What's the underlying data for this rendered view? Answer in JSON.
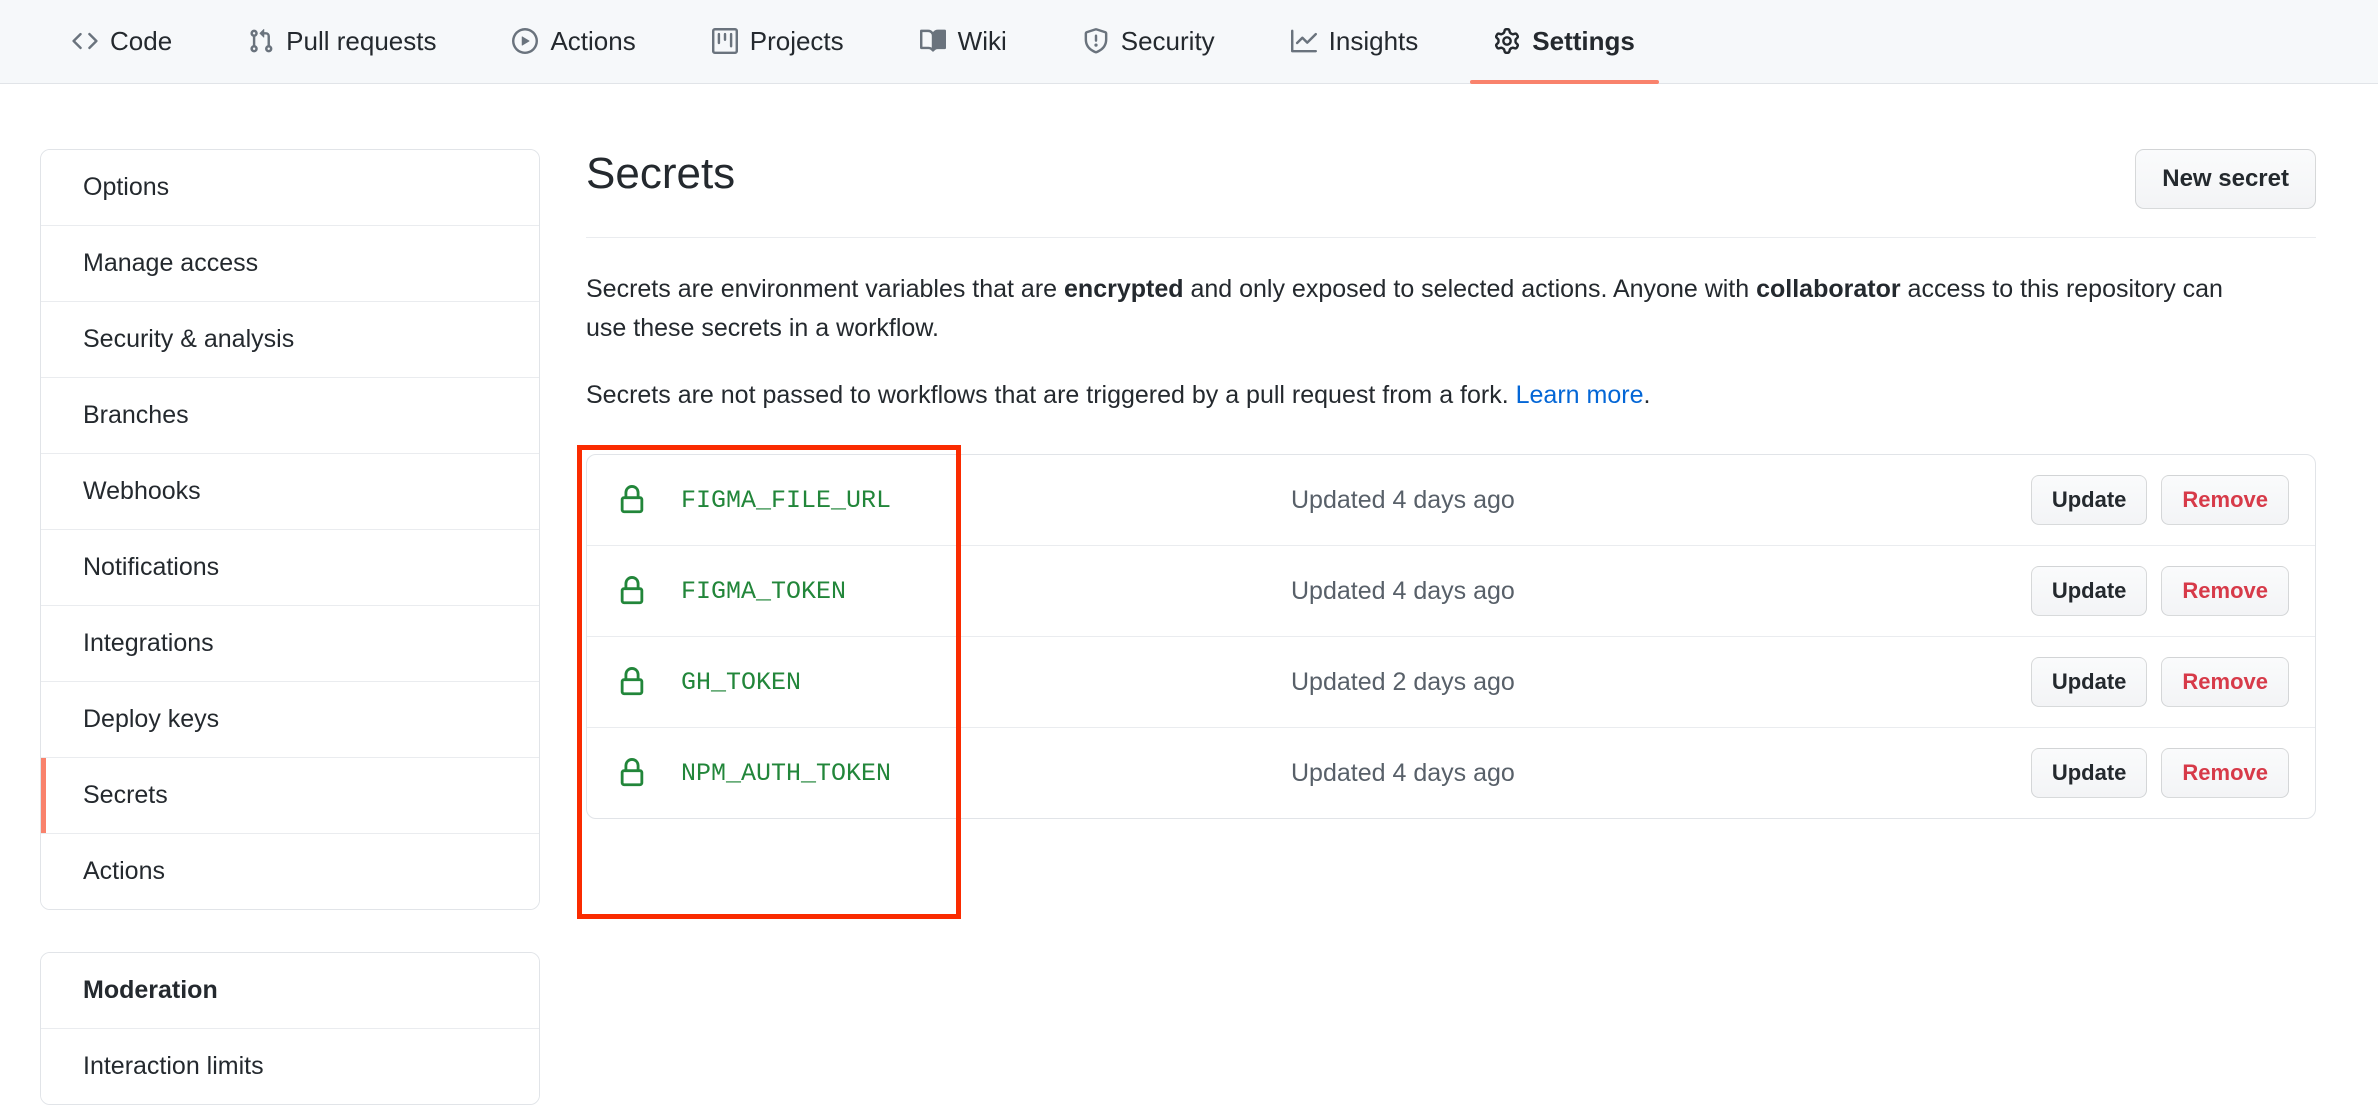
{
  "nav": {
    "tabs": [
      {
        "label": "Code",
        "icon": "code-icon",
        "active": false
      },
      {
        "label": "Pull requests",
        "icon": "git-pull-request-icon",
        "active": false
      },
      {
        "label": "Actions",
        "icon": "play-circle-icon",
        "active": false
      },
      {
        "label": "Projects",
        "icon": "project-board-icon",
        "active": false
      },
      {
        "label": "Wiki",
        "icon": "book-icon",
        "active": false
      },
      {
        "label": "Security",
        "icon": "shield-alert-icon",
        "active": false
      },
      {
        "label": "Insights",
        "icon": "graph-line-icon",
        "active": false
      },
      {
        "label": "Settings",
        "icon": "gear-icon",
        "active": true
      }
    ],
    "active_accent": "#f9826c"
  },
  "sidebar": {
    "groups": [
      {
        "items": [
          {
            "label": "Options",
            "selected": false,
            "heading": false
          },
          {
            "label": "Manage access",
            "selected": false,
            "heading": false
          },
          {
            "label": "Security & analysis",
            "selected": false,
            "heading": false
          },
          {
            "label": "Branches",
            "selected": false,
            "heading": false
          },
          {
            "label": "Webhooks",
            "selected": false,
            "heading": false
          },
          {
            "label": "Notifications",
            "selected": false,
            "heading": false
          },
          {
            "label": "Integrations",
            "selected": false,
            "heading": false
          },
          {
            "label": "Deploy keys",
            "selected": false,
            "heading": false
          },
          {
            "label": "Secrets",
            "selected": true,
            "heading": false
          },
          {
            "label": "Actions",
            "selected": false,
            "heading": false
          }
        ]
      },
      {
        "items": [
          {
            "label": "Moderation",
            "selected": false,
            "heading": true
          },
          {
            "label": "Interaction limits",
            "selected": false,
            "heading": false
          }
        ]
      }
    ]
  },
  "main": {
    "title": "Secrets",
    "new_secret_label": "New secret",
    "description_1": {
      "part1": "Secrets are environment variables that are ",
      "bold1": "encrypted",
      "part2": " and only exposed to selected actions. Anyone with ",
      "bold2": "collaborator",
      "part3": " access to this repository can use these secrets in a workflow."
    },
    "description_2": {
      "part1": "Secrets are not passed to workflows that are triggered by a pull request from a fork. ",
      "link": "Learn more",
      "part2": "."
    },
    "update_label": "Update",
    "remove_label": "Remove",
    "secrets": [
      {
        "name": "FIGMA_FILE_URL",
        "updated": "Updated 4 days ago",
        "icon": "lock-icon"
      },
      {
        "name": "FIGMA_TOKEN",
        "updated": "Updated 4 days ago",
        "icon": "lock-icon"
      },
      {
        "name": "GH_TOKEN",
        "updated": "Updated 2 days ago",
        "icon": "lock-icon"
      },
      {
        "name": "NPM_AUTH_TOKEN",
        "updated": "Updated 4 days ago",
        "icon": "lock-icon"
      }
    ]
  },
  "annotation": {
    "type": "highlight-rectangle",
    "color": "#fa2b00"
  },
  "colors": {
    "secret_name": "#22863a",
    "link": "#0366d6",
    "danger": "#d73a49",
    "accent": "#f9826c",
    "annotation": "#fa2b00"
  }
}
